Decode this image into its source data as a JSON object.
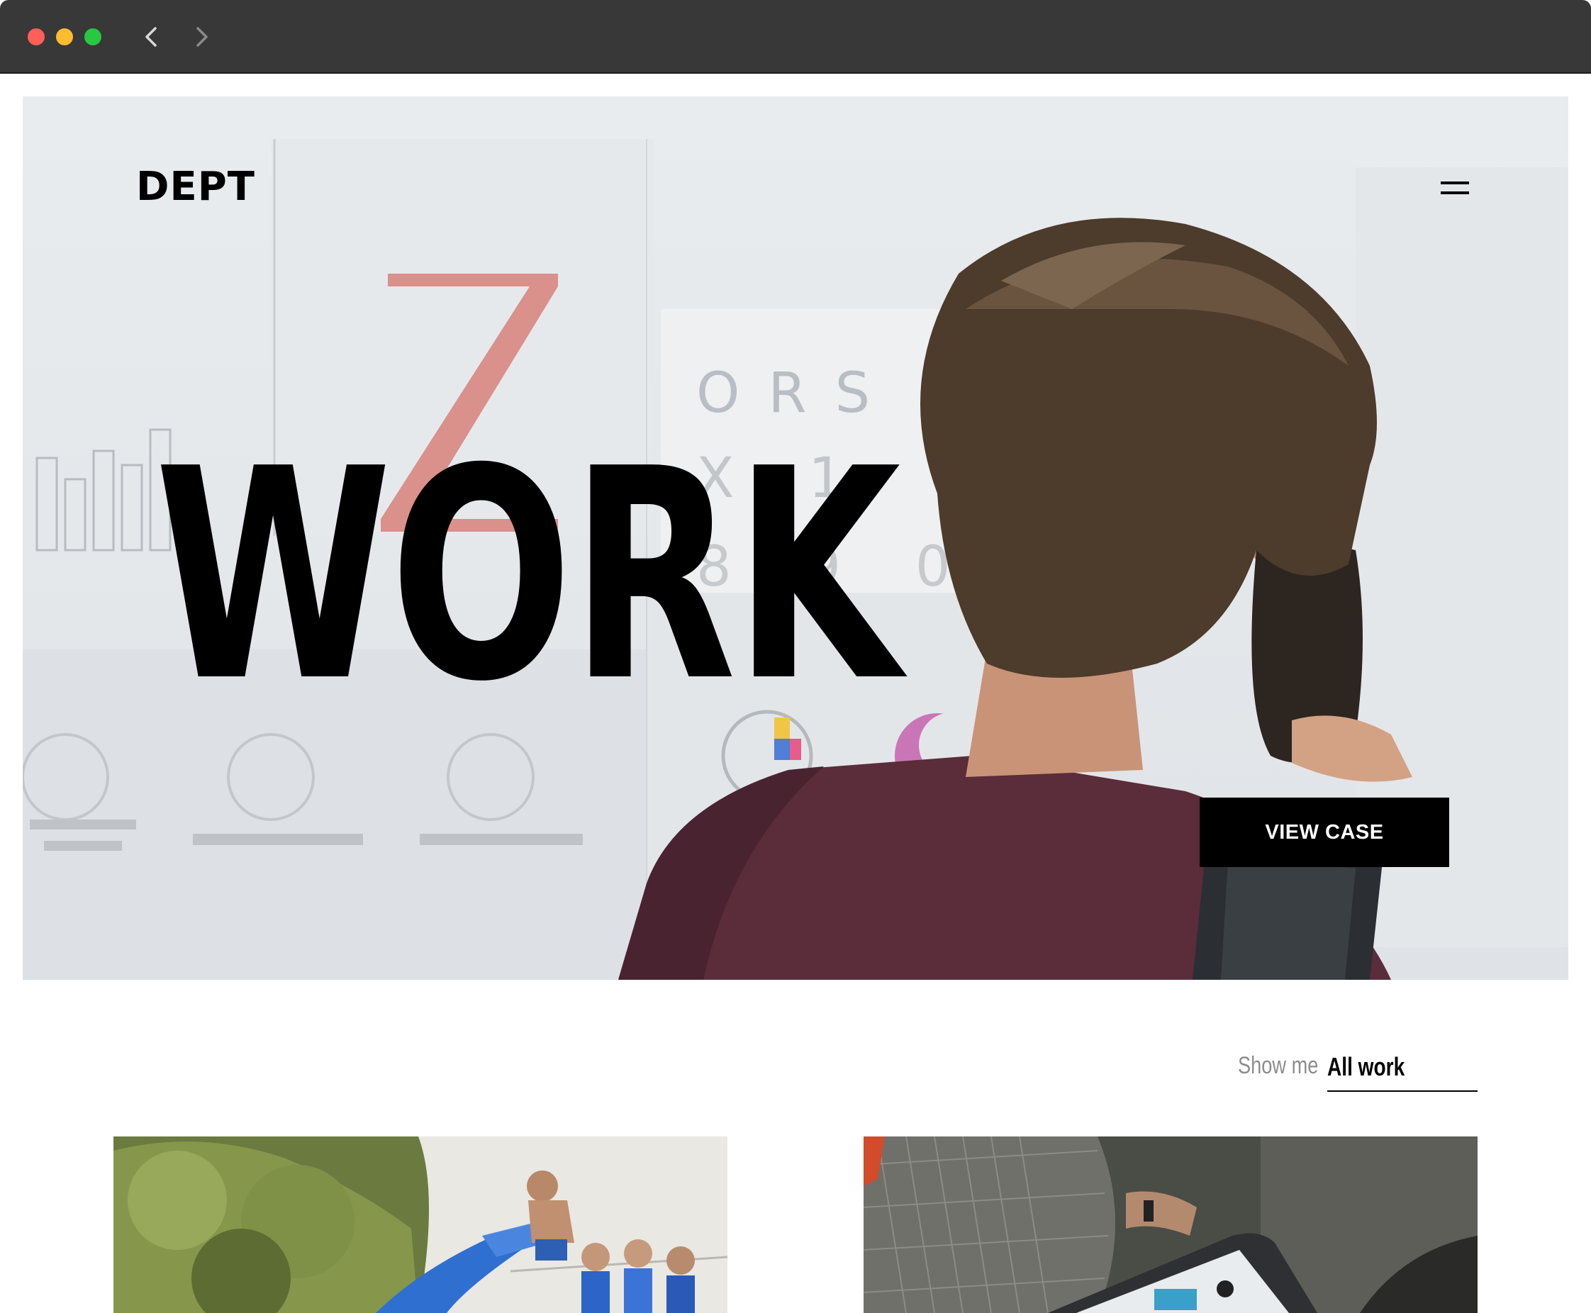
{
  "browser": {
    "controls": [
      "close",
      "minimize",
      "maximize"
    ],
    "nav_icons": [
      "back-arrow-icon",
      "forward-arrow-icon"
    ]
  },
  "header": {
    "logo": "DEPT",
    "menu_icon": "hamburger-menu-icon"
  },
  "hero": {
    "title": "WORK",
    "cta_label": "VIEW CASE"
  },
  "filter": {
    "label": "Show me",
    "value": "All work"
  },
  "cards": [
    {
      "image": "people at pool party with blue water slide"
    },
    {
      "image": "person using laptop"
    }
  ],
  "colors": {
    "chrome": "#383838",
    "accent": "#000000",
    "muted_text": "#8d8d8d",
    "background": "#ffffff"
  }
}
